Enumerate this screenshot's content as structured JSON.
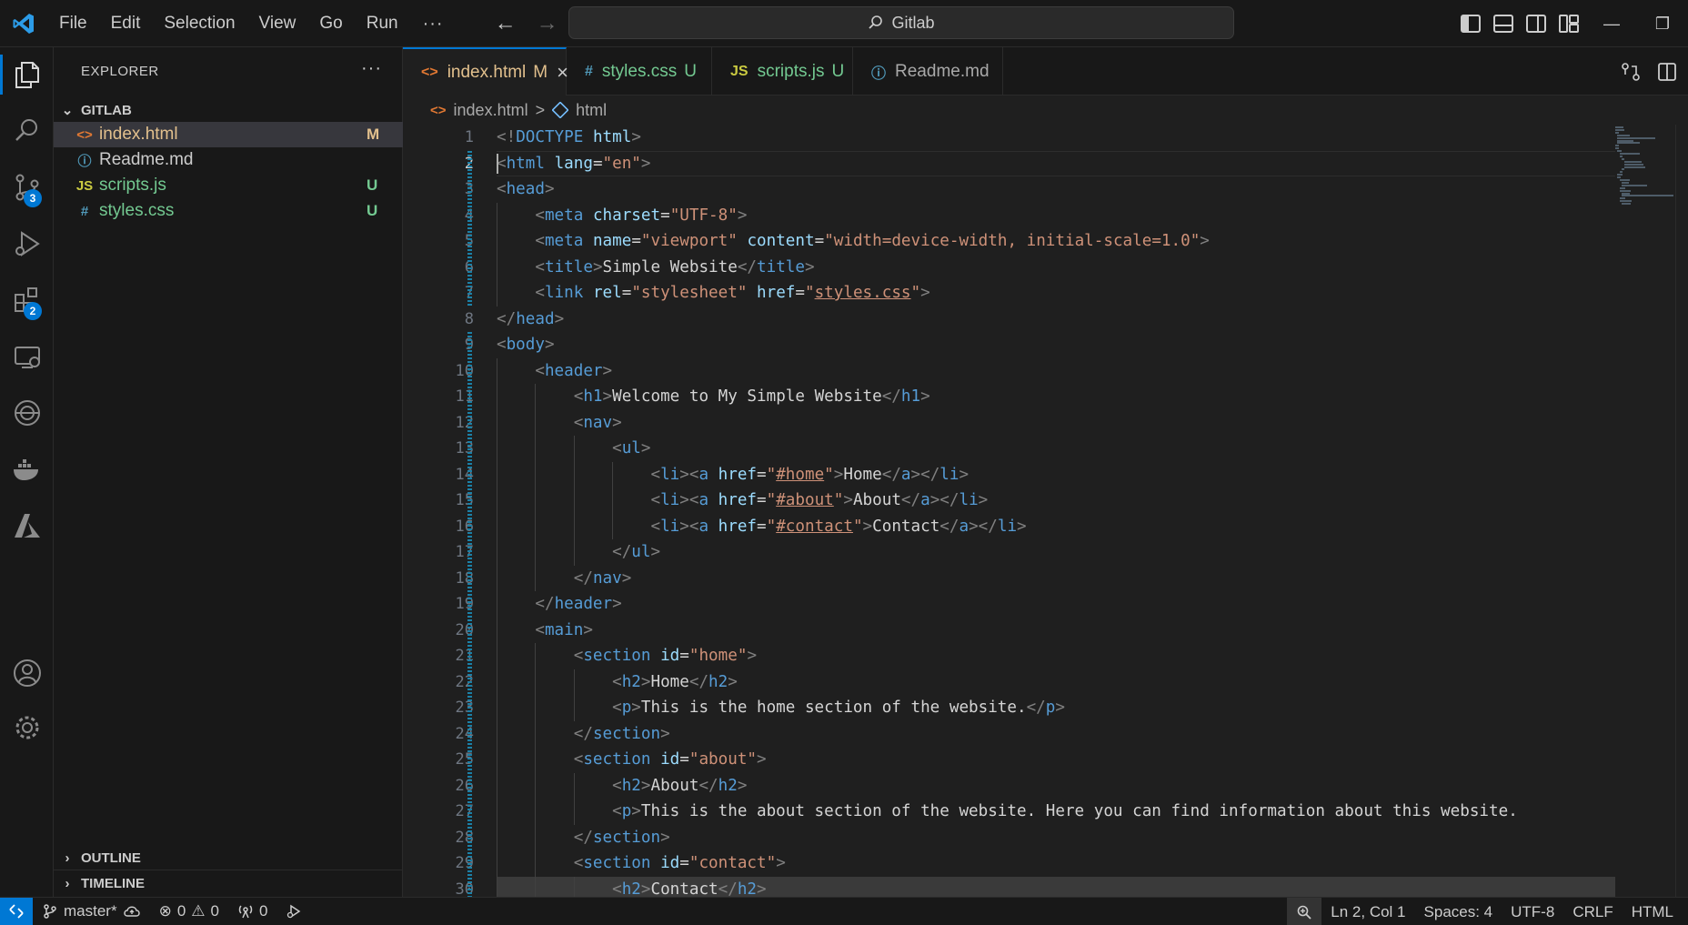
{
  "titlebar": {
    "menu": [
      "File",
      "Edit",
      "Selection",
      "View",
      "Go",
      "Run"
    ],
    "more": "···",
    "search_text": "Gitlab"
  },
  "activity": {
    "source_control_badge": "3",
    "extensions_badge": "2"
  },
  "sidebar": {
    "title": "EXPLORER",
    "more": "···",
    "folder": "GITLAB",
    "files": [
      {
        "icon": "<>",
        "name": "index.html",
        "status": "M",
        "color": "#e2c08d",
        "icon_color": "#e37933"
      },
      {
        "icon": "ⓘ",
        "name": "Readme.md",
        "status": "",
        "color": "#cccccc",
        "icon_color": "#519aba"
      },
      {
        "icon": "JS",
        "name": "scripts.js",
        "status": "U",
        "color": "#73c991",
        "icon_color": "#cbcb41"
      },
      {
        "icon": "#",
        "name": "styles.css",
        "status": "U",
        "color": "#73c991",
        "icon_color": "#519aba"
      }
    ],
    "outline": "OUTLINE",
    "timeline": "TIMELINE"
  },
  "tabs": [
    {
      "icon": "<>",
      "label": "index.html",
      "status": "M",
      "color": "#e2c08d",
      "icon_color": "#e37933",
      "active": true
    },
    {
      "icon": "#",
      "label": "styles.css",
      "status": "U",
      "color": "#73c991",
      "icon_color": "#519aba"
    },
    {
      "icon": "JS",
      "label": "scripts.js",
      "status": "U",
      "color": "#73c991",
      "icon_color": "#cbcb41"
    },
    {
      "icon": "ⓘ",
      "label": "Readme.md",
      "status": "",
      "color": "#a9a9a9",
      "icon_color": "#519aba"
    }
  ],
  "breadcrumb": {
    "file": "index.html",
    "separator": ">",
    "symbol": "html"
  },
  "editor": {
    "lines": [
      [
        [
          "k",
          "<!"
        ],
        [
          "t",
          "DOCTYPE"
        ],
        [
          "x",
          " "
        ],
        [
          "a",
          "html"
        ],
        [
          "k",
          ">"
        ]
      ],
      [
        [
          "k",
          "<"
        ],
        [
          "t",
          "html"
        ],
        [
          "x",
          " "
        ],
        [
          "a",
          "lang"
        ],
        [
          "x",
          "="
        ],
        [
          "s",
          "\"en\""
        ],
        [
          "k",
          ">"
        ]
      ],
      [
        [
          "k",
          "<"
        ],
        [
          "t",
          "head"
        ],
        [
          "k",
          ">"
        ]
      ],
      [
        [
          "x",
          "    "
        ],
        [
          "k",
          "<"
        ],
        [
          "t",
          "meta"
        ],
        [
          "x",
          " "
        ],
        [
          "a",
          "charset"
        ],
        [
          "x",
          "="
        ],
        [
          "s",
          "\"UTF-8\""
        ],
        [
          "k",
          ">"
        ]
      ],
      [
        [
          "x",
          "    "
        ],
        [
          "k",
          "<"
        ],
        [
          "t",
          "meta"
        ],
        [
          "x",
          " "
        ],
        [
          "a",
          "name"
        ],
        [
          "x",
          "="
        ],
        [
          "s",
          "\"viewport\""
        ],
        [
          "x",
          " "
        ],
        [
          "a",
          "content"
        ],
        [
          "x",
          "="
        ],
        [
          "s",
          "\"width=device-width, initial-scale=1.0\""
        ],
        [
          "k",
          ">"
        ]
      ],
      [
        [
          "x",
          "    "
        ],
        [
          "k",
          "<"
        ],
        [
          "t",
          "title"
        ],
        [
          "k",
          ">"
        ],
        [
          "x",
          "Simple Website"
        ],
        [
          "k",
          "</"
        ],
        [
          "t",
          "title"
        ],
        [
          "k",
          ">"
        ]
      ],
      [
        [
          "x",
          "    "
        ],
        [
          "k",
          "<"
        ],
        [
          "t",
          "link"
        ],
        [
          "x",
          " "
        ],
        [
          "a",
          "rel"
        ],
        [
          "x",
          "="
        ],
        [
          "s",
          "\"stylesheet\""
        ],
        [
          "x",
          " "
        ],
        [
          "a",
          "href"
        ],
        [
          "x",
          "="
        ],
        [
          "s",
          "\""
        ],
        [
          "su",
          "styles.css"
        ],
        [
          "s",
          "\""
        ],
        [
          "k",
          ">"
        ]
      ],
      [
        [
          "k",
          "</"
        ],
        [
          "t",
          "head"
        ],
        [
          "k",
          ">"
        ]
      ],
      [
        [
          "k",
          "<"
        ],
        [
          "t",
          "body"
        ],
        [
          "k",
          ">"
        ]
      ],
      [
        [
          "x",
          "    "
        ],
        [
          "k",
          "<"
        ],
        [
          "t",
          "header"
        ],
        [
          "k",
          ">"
        ]
      ],
      [
        [
          "x",
          "        "
        ],
        [
          "k",
          "<"
        ],
        [
          "t",
          "h1"
        ],
        [
          "k",
          ">"
        ],
        [
          "x",
          "Welcome to My Simple Website"
        ],
        [
          "k",
          "</"
        ],
        [
          "t",
          "h1"
        ],
        [
          "k",
          ">"
        ]
      ],
      [
        [
          "x",
          "        "
        ],
        [
          "k",
          "<"
        ],
        [
          "t",
          "nav"
        ],
        [
          "k",
          ">"
        ]
      ],
      [
        [
          "x",
          "            "
        ],
        [
          "k",
          "<"
        ],
        [
          "t",
          "ul"
        ],
        [
          "k",
          ">"
        ]
      ],
      [
        [
          "x",
          "                "
        ],
        [
          "k",
          "<"
        ],
        [
          "t",
          "li"
        ],
        [
          "k",
          "><"
        ],
        [
          "t",
          "a"
        ],
        [
          "x",
          " "
        ],
        [
          "a",
          "href"
        ],
        [
          "x",
          "="
        ],
        [
          "s",
          "\""
        ],
        [
          "su",
          "#home"
        ],
        [
          "s",
          "\""
        ],
        [
          "k",
          ">"
        ],
        [
          "x",
          "Home"
        ],
        [
          "k",
          "</"
        ],
        [
          "t",
          "a"
        ],
        [
          "k",
          "></"
        ],
        [
          "t",
          "li"
        ],
        [
          "k",
          ">"
        ]
      ],
      [
        [
          "x",
          "                "
        ],
        [
          "k",
          "<"
        ],
        [
          "t",
          "li"
        ],
        [
          "k",
          "><"
        ],
        [
          "t",
          "a"
        ],
        [
          "x",
          " "
        ],
        [
          "a",
          "href"
        ],
        [
          "x",
          "="
        ],
        [
          "s",
          "\""
        ],
        [
          "su",
          "#about"
        ],
        [
          "s",
          "\""
        ],
        [
          "k",
          ">"
        ],
        [
          "x",
          "About"
        ],
        [
          "k",
          "</"
        ],
        [
          "t",
          "a"
        ],
        [
          "k",
          "></"
        ],
        [
          "t",
          "li"
        ],
        [
          "k",
          ">"
        ]
      ],
      [
        [
          "x",
          "                "
        ],
        [
          "k",
          "<"
        ],
        [
          "t",
          "li"
        ],
        [
          "k",
          "><"
        ],
        [
          "t",
          "a"
        ],
        [
          "x",
          " "
        ],
        [
          "a",
          "href"
        ],
        [
          "x",
          "="
        ],
        [
          "s",
          "\""
        ],
        [
          "su",
          "#contact"
        ],
        [
          "s",
          "\""
        ],
        [
          "k",
          ">"
        ],
        [
          "x",
          "Contact"
        ],
        [
          "k",
          "</"
        ],
        [
          "t",
          "a"
        ],
        [
          "k",
          "></"
        ],
        [
          "t",
          "li"
        ],
        [
          "k",
          ">"
        ]
      ],
      [
        [
          "x",
          "            "
        ],
        [
          "k",
          "</"
        ],
        [
          "t",
          "ul"
        ],
        [
          "k",
          ">"
        ]
      ],
      [
        [
          "x",
          "        "
        ],
        [
          "k",
          "</"
        ],
        [
          "t",
          "nav"
        ],
        [
          "k",
          ">"
        ]
      ],
      [
        [
          "x",
          "    "
        ],
        [
          "k",
          "</"
        ],
        [
          "t",
          "header"
        ],
        [
          "k",
          ">"
        ]
      ],
      [
        [
          "x",
          "    "
        ],
        [
          "k",
          "<"
        ],
        [
          "t",
          "main"
        ],
        [
          "k",
          ">"
        ]
      ],
      [
        [
          "x",
          "        "
        ],
        [
          "k",
          "<"
        ],
        [
          "t",
          "section"
        ],
        [
          "x",
          " "
        ],
        [
          "a",
          "id"
        ],
        [
          "x",
          "="
        ],
        [
          "s",
          "\"home\""
        ],
        [
          "k",
          ">"
        ]
      ],
      [
        [
          "x",
          "            "
        ],
        [
          "k",
          "<"
        ],
        [
          "t",
          "h2"
        ],
        [
          "k",
          ">"
        ],
        [
          "x",
          "Home"
        ],
        [
          "k",
          "</"
        ],
        [
          "t",
          "h2"
        ],
        [
          "k",
          ">"
        ]
      ],
      [
        [
          "x",
          "            "
        ],
        [
          "k",
          "<"
        ],
        [
          "t",
          "p"
        ],
        [
          "k",
          ">"
        ],
        [
          "x",
          "This is the home section of the website."
        ],
        [
          "k",
          "</"
        ],
        [
          "t",
          "p"
        ],
        [
          "k",
          ">"
        ]
      ],
      [
        [
          "x",
          "        "
        ],
        [
          "k",
          "</"
        ],
        [
          "t",
          "section"
        ],
        [
          "k",
          ">"
        ]
      ],
      [
        [
          "x",
          "        "
        ],
        [
          "k",
          "<"
        ],
        [
          "t",
          "section"
        ],
        [
          "x",
          " "
        ],
        [
          "a",
          "id"
        ],
        [
          "x",
          "="
        ],
        [
          "s",
          "\"about\""
        ],
        [
          "k",
          ">"
        ]
      ],
      [
        [
          "x",
          "            "
        ],
        [
          "k",
          "<"
        ],
        [
          "t",
          "h2"
        ],
        [
          "k",
          ">"
        ],
        [
          "x",
          "About"
        ],
        [
          "k",
          "</"
        ],
        [
          "t",
          "h2"
        ],
        [
          "k",
          ">"
        ]
      ],
      [
        [
          "x",
          "            "
        ],
        [
          "k",
          "<"
        ],
        [
          "t",
          "p"
        ],
        [
          "k",
          ">"
        ],
        [
          "x",
          "This is the about section of the website. Here you can find information about this website."
        ]
      ],
      [
        [
          "x",
          "        "
        ],
        [
          "k",
          "</"
        ],
        [
          "t",
          "section"
        ],
        [
          "k",
          ">"
        ]
      ],
      [
        [
          "x",
          "        "
        ],
        [
          "k",
          "<"
        ],
        [
          "t",
          "section"
        ],
        [
          "x",
          " "
        ],
        [
          "a",
          "id"
        ],
        [
          "x",
          "="
        ],
        [
          "s",
          "\"contact\""
        ],
        [
          "k",
          ">"
        ]
      ],
      [
        [
          "x",
          "            "
        ],
        [
          "k",
          "<"
        ],
        [
          "t",
          "h2"
        ],
        [
          "k",
          ">"
        ],
        [
          "x",
          "Contact"
        ],
        [
          "k",
          "</"
        ],
        [
          "t",
          "h2"
        ],
        [
          "k",
          ">"
        ]
      ]
    ],
    "current_line": 2
  },
  "statusbar": {
    "branch": "master*",
    "errors": "0",
    "warnings": "0",
    "ports": "0",
    "position": "Ln 2, Col 1",
    "spaces": "Spaces: 4",
    "encoding": "UTF-8",
    "eol": "CRLF",
    "language": "HTML"
  },
  "colors": {
    "accent": "#0078d4",
    "modified": "#e2c08d",
    "untracked": "#73c991"
  }
}
